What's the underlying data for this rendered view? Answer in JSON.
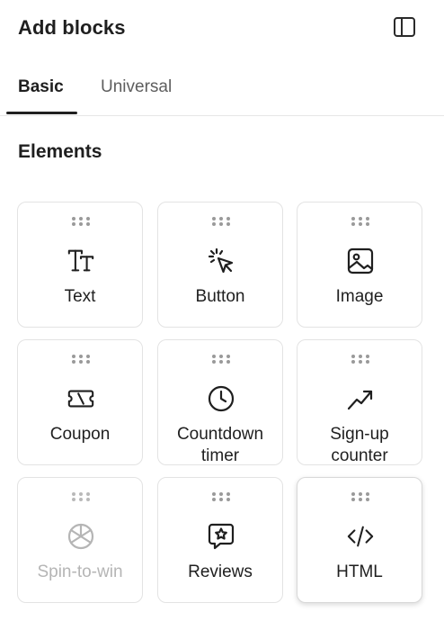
{
  "header": {
    "title": "Add blocks",
    "panel_icon": "sidebar-panel-icon"
  },
  "tabs": [
    {
      "label": "Basic",
      "active": true
    },
    {
      "label": "Universal",
      "active": false
    }
  ],
  "section": {
    "title": "Elements"
  },
  "blocks": [
    {
      "label": "Text",
      "icon": "text-size-icon"
    },
    {
      "label": "Button",
      "icon": "cursor-click-icon"
    },
    {
      "label": "Image",
      "icon": "image-icon"
    },
    {
      "label": "Coupon",
      "icon": "ticket-icon"
    },
    {
      "label": "Countdown\ntimer",
      "icon": "clock-icon"
    },
    {
      "label": "Sign-up\ncounter",
      "icon": "trending-up-icon"
    },
    {
      "label": "Spin-to-win",
      "icon": "wheel-icon",
      "disabled": true
    },
    {
      "label": "Reviews",
      "icon": "star-message-icon"
    },
    {
      "label": "HTML",
      "icon": "code-icon",
      "selected": true
    }
  ],
  "colors": {
    "text": "#1f1f1f",
    "muted": "#5e5e5e",
    "disabled": "#b5b5b5",
    "border": "#e3e3e3",
    "grip": "#9a9a9a"
  }
}
